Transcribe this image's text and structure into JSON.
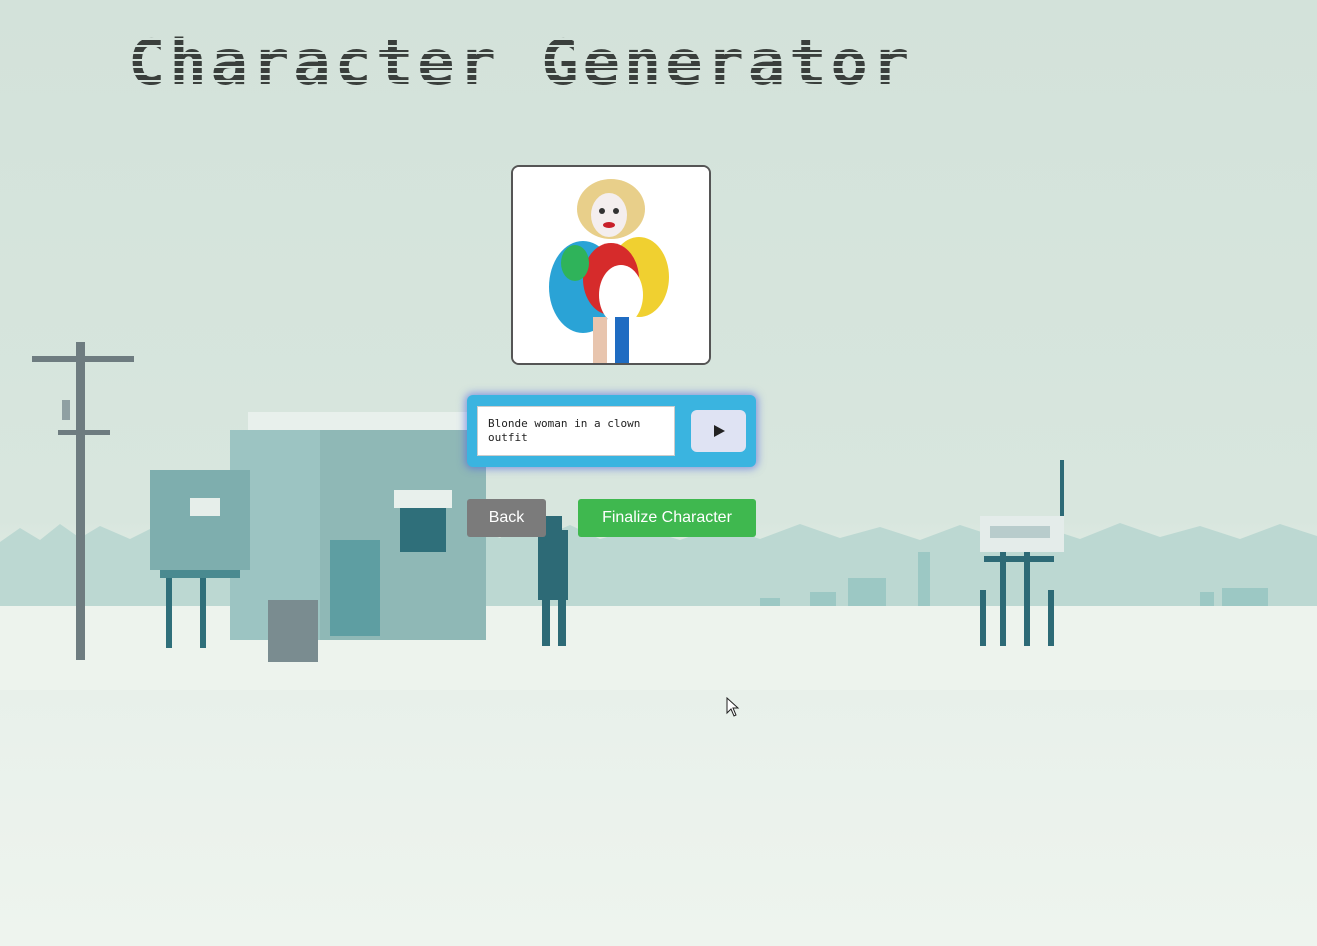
{
  "page": {
    "title": "Character Generator"
  },
  "portrait": {
    "alt": "Blonde woman in a clown outfit"
  },
  "prompt": {
    "value": "Blonde woman in a clown outfit"
  },
  "buttons": {
    "back_label": "Back",
    "finalize_label": "Finalize Character"
  },
  "icons": {
    "submit": "play-icon",
    "cursor": "mouse-cursor-icon"
  },
  "colors": {
    "prompt_panel": "#3ab4e0",
    "finalize": "#3fb84f",
    "back": "#7b7b7b",
    "submit_bg": "#dfe3f3"
  }
}
